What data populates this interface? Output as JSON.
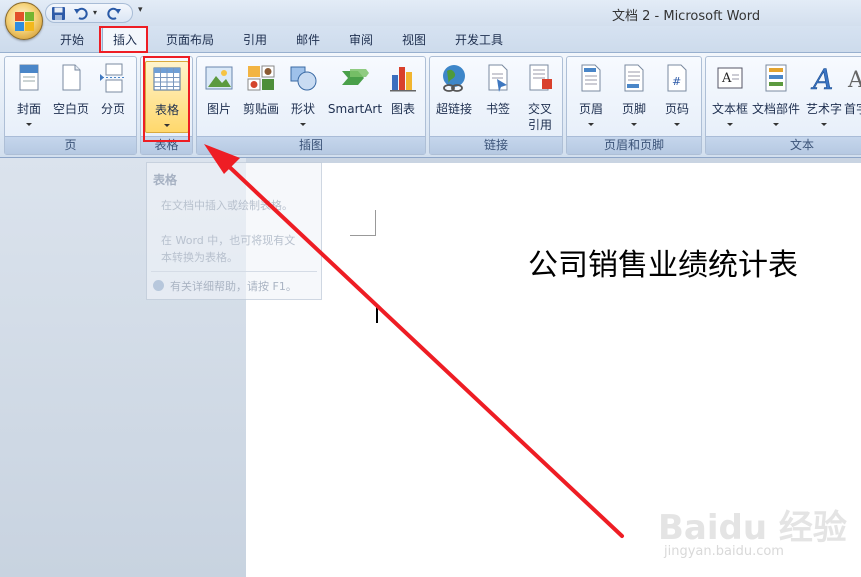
{
  "window": {
    "title": "文档 2 - Microsoft Word"
  },
  "quick_access": {
    "items": [
      "save-icon",
      "undo-icon",
      "redo-icon"
    ],
    "more": "▾"
  },
  "tabs": [
    {
      "label": "开始"
    },
    {
      "label": "插入",
      "active": true
    },
    {
      "label": "页面布局"
    },
    {
      "label": "引用"
    },
    {
      "label": "邮件"
    },
    {
      "label": "审阅"
    },
    {
      "label": "视图"
    },
    {
      "label": "开发工具"
    }
  ],
  "ribbon": {
    "groups": {
      "pages": {
        "label": "页",
        "buttons": [
          "封面",
          "空白页",
          "分页"
        ]
      },
      "table": {
        "label": "表格",
        "buttons": [
          "表格"
        ]
      },
      "illustrations": {
        "label": "插图",
        "buttons": [
          "图片",
          "剪贴画",
          "形状",
          "SmartArt",
          "图表"
        ]
      },
      "links": {
        "label": "链接",
        "buttons": [
          "超链接",
          "书签",
          "交叉\n引用"
        ]
      },
      "header_footer": {
        "label": "页眉和页脚",
        "buttons": [
          "页眉",
          "页脚",
          "页码"
        ]
      },
      "text": {
        "label": "文本",
        "buttons": [
          "文本框",
          "文档部件",
          "艺术字",
          "首字"
        ]
      }
    }
  },
  "tooltip": {
    "title": "表格",
    "line1": "在文档中插入或绘制表格。",
    "line2": "在 Word 中，也可将现有文",
    "line3": "本转换为表格。",
    "help": "有关详细帮助，请按 F1。"
  },
  "document": {
    "heading": "公司销售业绩统计表"
  },
  "watermark": {
    "main": "Baidu 经验",
    "sub": "jingyan.baidu.com"
  },
  "colors": {
    "highlight_red": "#ee1d24",
    "ribbon_bg": "#dfe9f5",
    "doc_bg": "#ffffff"
  }
}
